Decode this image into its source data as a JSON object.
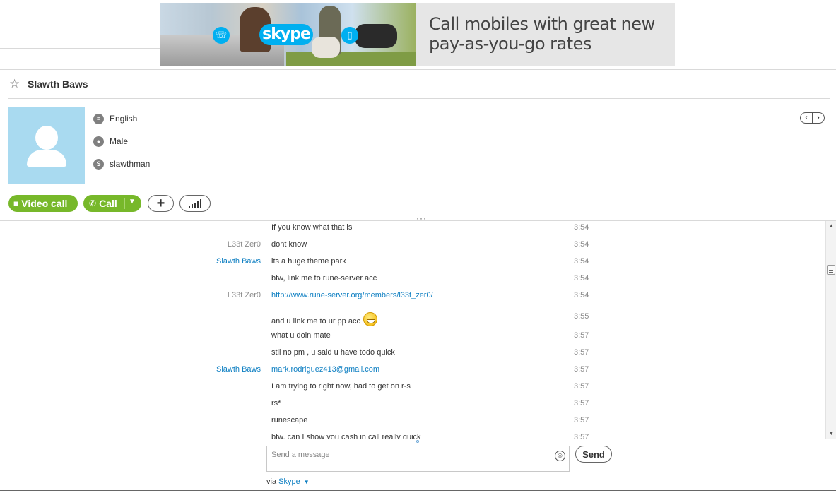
{
  "ad": {
    "logo_text": "skype",
    "headline": "Call mobiles with great new pay-as-you-go rates"
  },
  "contact": {
    "name": "Slawth Baws",
    "language": "English",
    "gender": "Male",
    "skype_name": "slawthman"
  },
  "actions": {
    "video_call_label": "Video call",
    "call_label": "Call"
  },
  "messages": [
    {
      "sender": "",
      "sender_type": "",
      "text": "If you know what that is",
      "time": "3:54",
      "is_link": false
    },
    {
      "sender": "L33t Zer0",
      "sender_type": "them",
      "text": "dont know",
      "time": "3:54",
      "is_link": false
    },
    {
      "sender": "Slawth Baws",
      "sender_type": "me",
      "text": "its a huge theme park",
      "time": "3:54",
      "is_link": false
    },
    {
      "sender": "",
      "sender_type": "",
      "text": "btw, link me to rune-server acc",
      "time": "3:54",
      "is_link": false
    },
    {
      "sender": "L33t Zer0",
      "sender_type": "them",
      "text": "http://www.rune-server.org/members/l33t_zer0/",
      "time": "3:54",
      "is_link": true
    },
    {
      "sender": "",
      "sender_type": "",
      "text": "and u link me to ur pp acc",
      "time": "3:55",
      "is_link": false,
      "emoji": "grin-emoji"
    },
    {
      "sender": "",
      "sender_type": "",
      "text": "what u doin mate",
      "time": "3:57",
      "is_link": false
    },
    {
      "sender": "",
      "sender_type": "",
      "text": "stil no pm , u said u have todo quick",
      "time": "3:57",
      "is_link": false
    },
    {
      "sender": "Slawth Baws",
      "sender_type": "me",
      "text": "mark.rodriguez413@gmail.com",
      "time": "3:57",
      "is_link": true
    },
    {
      "sender": "",
      "sender_type": "",
      "text": "I am trying to right now, had to get on r-s",
      "time": "3:57",
      "is_link": false
    },
    {
      "sender": "",
      "sender_type": "",
      "text": "rs*",
      "time": "3:57",
      "is_link": false
    },
    {
      "sender": "",
      "sender_type": "",
      "text": "runescape",
      "time": "3:57",
      "is_link": false
    },
    {
      "sender": "",
      "sender_type": "",
      "text": "btw, can I show you cash in call really quick",
      "time": "3:57",
      "is_link": false
    }
  ],
  "composer": {
    "placeholder": "Send a message",
    "send_label": "Send"
  },
  "footer": {
    "via_label": "via",
    "via_link": "Skype"
  },
  "colors": {
    "accent_green": "#77b82a",
    "link_blue": "#0e7fc2",
    "avatar_bg": "#a9daf0"
  }
}
